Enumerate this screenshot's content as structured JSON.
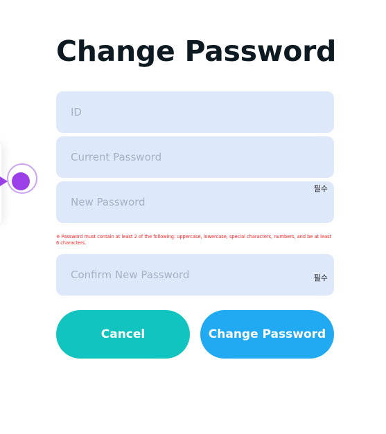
{
  "page": {
    "title": "Change Password"
  },
  "form": {
    "id_placeholder": "ID",
    "current_password_placeholder": "Current Password",
    "new_password_placeholder": "New Password",
    "confirm_password_placeholder": "Confirm New Password",
    "required_label": "필수",
    "password_hint": "※ Password must contain at least 2 of the following: uppercase, lowercase, special characters, numbers, and be at least 6 characters."
  },
  "buttons": {
    "cancel_label": "Cancel",
    "change_label": "Change Password"
  },
  "colors": {
    "title": "#0e1a22",
    "field_bg": "#dde9fa",
    "cancel_button": "#11c4c0",
    "change_button": "#21aaf2",
    "hint_text": "#ff2020",
    "cursor_marker": "#9b3fe8"
  }
}
